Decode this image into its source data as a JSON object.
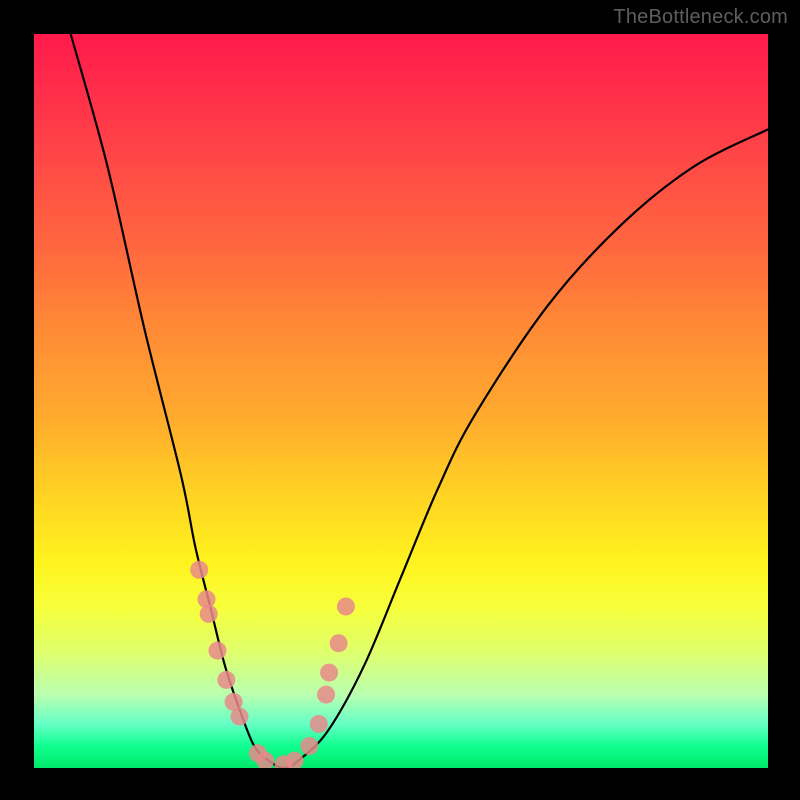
{
  "watermark": "TheBottleneck.com",
  "chart_data": {
    "type": "line",
    "title": "",
    "xlabel": "",
    "ylabel": "",
    "xlim": [
      0,
      100
    ],
    "ylim": [
      0,
      100
    ],
    "grid": false,
    "legend": false,
    "series": [
      {
        "name": "bottleneck-curve",
        "x": [
          5,
          10,
          15,
          20,
          22,
          24,
          26,
          28,
          30,
          32,
          34,
          36,
          40,
          45,
          50,
          55,
          60,
          70,
          80,
          90,
          100
        ],
        "y": [
          100,
          82,
          60,
          40,
          30,
          22,
          14,
          8,
          3,
          1,
          0,
          1,
          5,
          14,
          26,
          38,
          48,
          63,
          74,
          82,
          87
        ]
      }
    ],
    "markers": {
      "name": "highlight-dots",
      "x": [
        22.5,
        23.5,
        23.8,
        25.0,
        26.2,
        27.2,
        28.0,
        30.5,
        31.5,
        34.0,
        35.5,
        37.5,
        38.8,
        39.8,
        40.2,
        41.5,
        42.5
      ],
      "y": [
        27,
        23,
        21,
        16,
        12,
        9,
        7,
        2,
        1,
        0.5,
        1,
        3,
        6,
        10,
        13,
        17,
        22
      ]
    },
    "background_gradient": {
      "top": "#ff1a4b",
      "mid": "#fff31e",
      "bottom": "#00e86a"
    }
  }
}
